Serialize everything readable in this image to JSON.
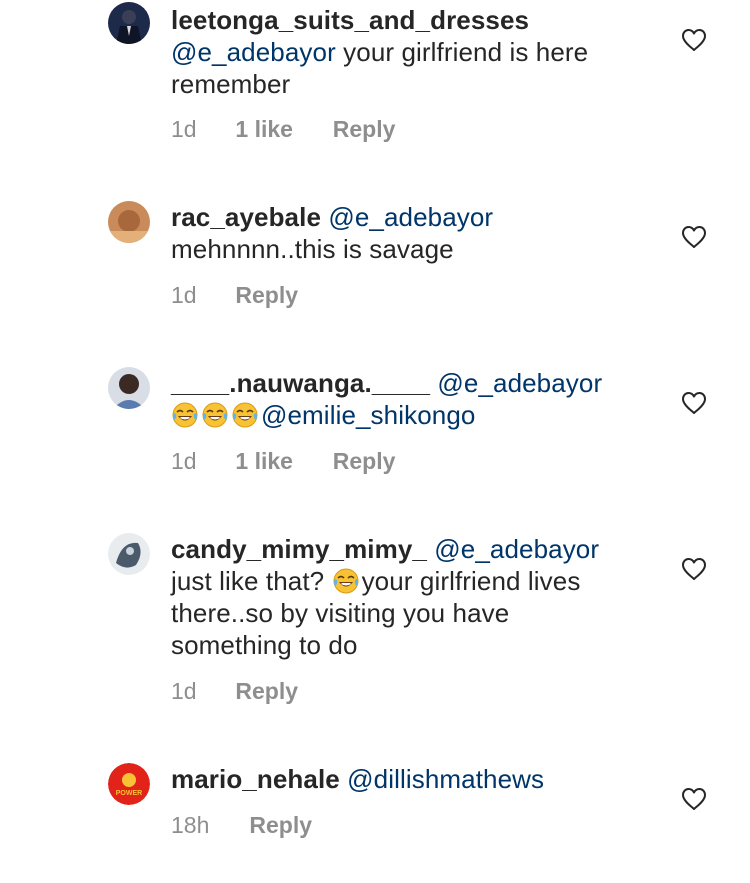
{
  "comments": [
    {
      "username": "leetonga_suits_and_dresses",
      "mention": "@e_adebayor",
      "text_line1": " your girlfriend is here",
      "text_line2": "remember",
      "time": "1d",
      "likes": "1 like",
      "reply": "Reply"
    },
    {
      "username": "rac_ayebale",
      "mention": "@e_adebayor",
      "text_line2": "mehnnnn..this is savage",
      "time": "1d",
      "reply": "Reply"
    },
    {
      "username": "____.nauwanga.____",
      "mention": "@e_adebayor",
      "mention2": "@emilie_shikongo",
      "time": "1d",
      "likes": "1 like",
      "reply": "Reply"
    },
    {
      "username": "candy_mimy_mimy_",
      "mention": "@e_adebayor",
      "text_line2a": "just like that? ",
      "text_line2b": "your girlfriend lives",
      "text_line3": "there..so by visiting you have",
      "text_line4": "something to do",
      "time": "1d",
      "reply": "Reply"
    },
    {
      "username": "mario_nehale",
      "mention": "@dillishmathews",
      "avatar_text": "POWER",
      "time": "18h",
      "reply": "Reply"
    }
  ],
  "icons": {
    "like": "heart-outline-icon",
    "emoji": "face-with-tears-of-joy-emoji"
  },
  "colors": {
    "username": "#262626",
    "mention": "#003569",
    "meta": "#8e8e8e",
    "heart_stroke": "#262626"
  }
}
